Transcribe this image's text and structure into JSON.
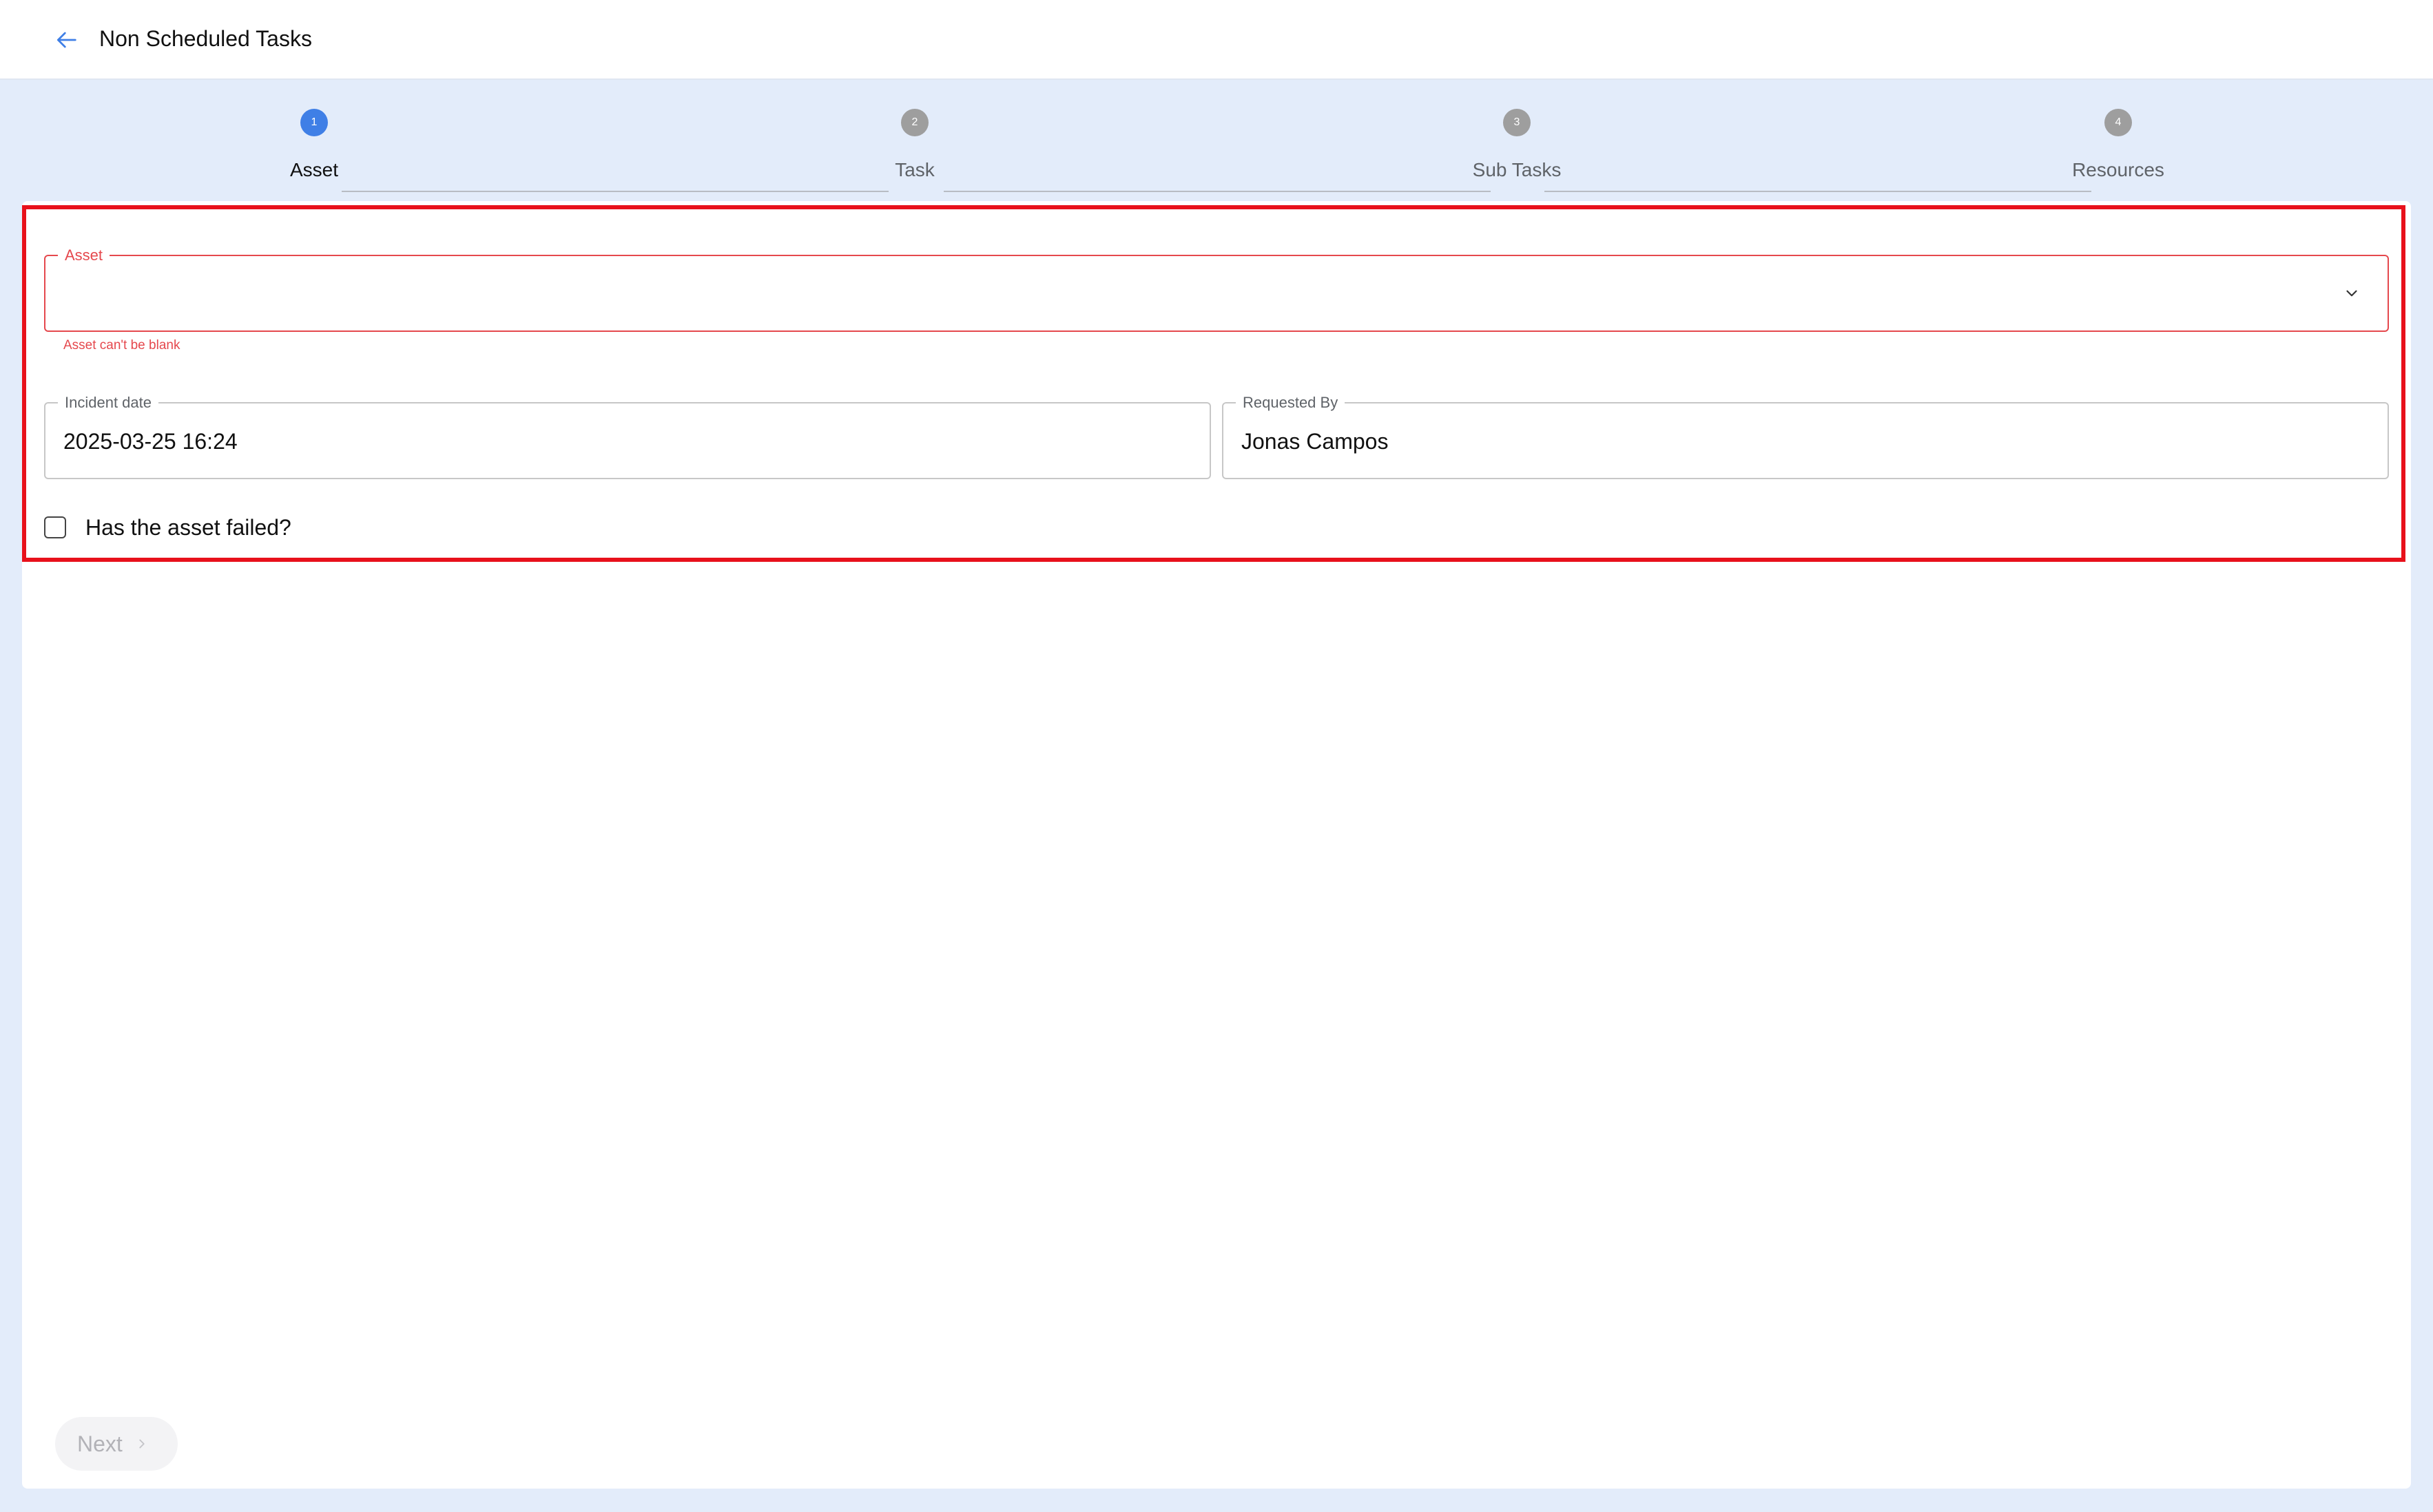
{
  "header": {
    "title": "Non Scheduled Tasks",
    "back_icon": "arrow-left-icon"
  },
  "stepper": {
    "steps": [
      {
        "number": "1",
        "label": "Asset",
        "active": true
      },
      {
        "number": "2",
        "label": "Task",
        "active": false
      },
      {
        "number": "3",
        "label": "Sub Tasks",
        "active": false
      },
      {
        "number": "4",
        "label": "Resources",
        "active": false
      }
    ]
  },
  "form": {
    "asset": {
      "label": "Asset",
      "value": "",
      "error": "Asset can't be blank",
      "icon": "chevron-down-icon"
    },
    "incident_date": {
      "label": "Incident date",
      "value": "2025-03-25 16:24"
    },
    "requested_by": {
      "label": "Requested By",
      "value": "Jonas Campos"
    },
    "asset_failed": {
      "label": "Has the asset failed?",
      "checked": false
    }
  },
  "footer": {
    "next_label": "Next",
    "next_icon": "chevron-right-icon"
  },
  "colors": {
    "accent": "#3f7fe6",
    "error": "#e5484d",
    "highlight": "#e8111b",
    "background": "#e3ecfa"
  }
}
